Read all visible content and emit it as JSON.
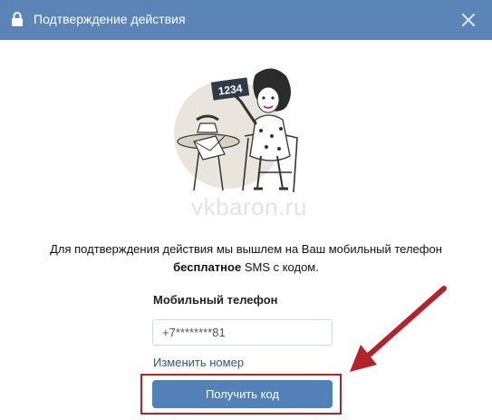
{
  "dialog": {
    "title": "Подтверждение действия",
    "lock_icon": "lock-icon",
    "close_icon": "close-icon"
  },
  "illustration": {
    "card_text": "1234"
  },
  "watermark": "vkbaron.ru",
  "message": {
    "text_before": "Для подтверждения действия мы вышлем на Ваш мобильный телефон",
    "bold_word": "бесплатное",
    "text_after": " SMS с кодом."
  },
  "form": {
    "phone_label": "Мобильный телефон",
    "phone_value": "+7********81",
    "change_number_link": "Изменить номер",
    "get_code_button": "Получить код"
  },
  "colors": {
    "header": "#5b85b6",
    "button": "#5181b8",
    "link": "#2a5885",
    "annotation": "#b3232a"
  }
}
